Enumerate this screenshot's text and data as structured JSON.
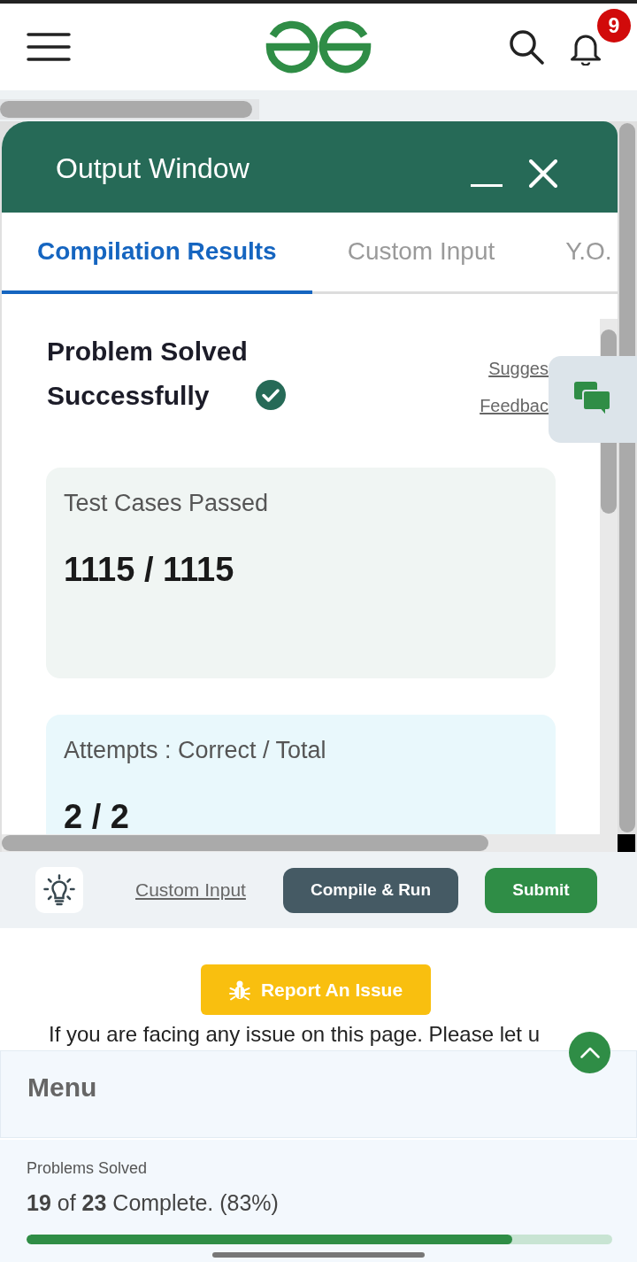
{
  "header": {
    "notification_count": "9"
  },
  "output_window": {
    "title": "Output Window",
    "tabs": [
      {
        "label": "Compilation Results",
        "selected": true
      },
      {
        "label": "Custom Input",
        "selected": false
      },
      {
        "label": "Y.O.",
        "selected": false
      }
    ],
    "result": {
      "title": "Problem Solved Successfully",
      "links": [
        "Sugges",
        "Feedbac"
      ]
    },
    "stat_cards": [
      {
        "label": "Test Cases Passed",
        "value": "1115 / 1115",
        "color": "#f0f5f3"
      },
      {
        "label": "Attempts : Correct / Total",
        "value": "2 / 2",
        "color": "#e9f8fc"
      }
    ]
  },
  "toolbar": {
    "link": "Custom Input",
    "buttons": [
      {
        "label": "Compile & Run",
        "kind": "secondary"
      },
      {
        "label": "Submit",
        "kind": "primary"
      }
    ]
  },
  "report": {
    "button": "Report An Issue",
    "message": "If you are facing any issue on this page. Please let u"
  },
  "menu": {
    "title": "Menu"
  },
  "progress": {
    "label": "Problems Solved",
    "summary": "**19** of **23** Complete. (83%)",
    "level": 0.83
  }
}
